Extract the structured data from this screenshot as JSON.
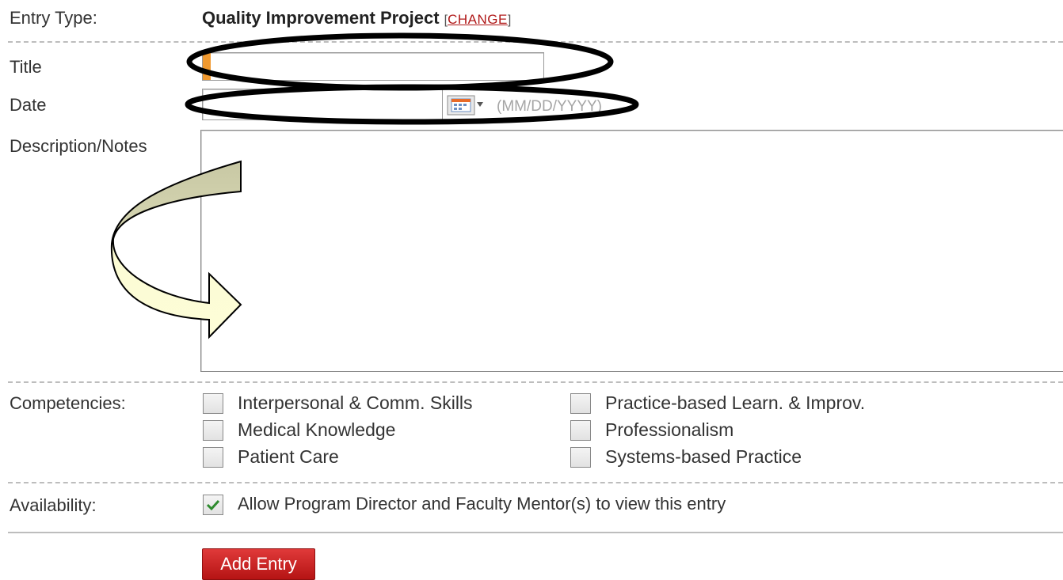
{
  "form": {
    "entry_type_label": "Entry Type:",
    "entry_type_value": "Quality Improvement Project",
    "change_open": "[",
    "change_link": "CHANGE",
    "change_close": "]",
    "title_label": "Title",
    "title_value": "",
    "date_label": "Date",
    "date_value": "",
    "date_hint": "(MM/DD/YYYY)",
    "description_label": "Description/Notes",
    "description_value": "",
    "competencies_label": "Competencies:",
    "competencies": [
      {
        "label": "Interpersonal & Comm. Skills",
        "checked": false
      },
      {
        "label": "Medical Knowledge",
        "checked": false
      },
      {
        "label": "Patient Care",
        "checked": false
      },
      {
        "label": "Practice-based Learn. & Improv.",
        "checked": false
      },
      {
        "label": "Professionalism",
        "checked": false
      },
      {
        "label": "Systems-based Practice",
        "checked": false
      }
    ],
    "availability_label": "Availability:",
    "availability_option": {
      "label": "Allow Program Director and Faculty Mentor(s) to view this entry",
      "checked": true
    },
    "submit_label": "Add Entry"
  },
  "icons": {
    "calendar": "calendar-icon",
    "checkmark": "checkmark-icon"
  },
  "colors": {
    "focus_accent": "#f0992f",
    "button_red": "#c82020",
    "link_red": "#b01818",
    "annotation_outline": "#000000",
    "arrow_fill_top": "#c8c8a4",
    "arrow_fill_bottom": "#fcfcd4"
  }
}
